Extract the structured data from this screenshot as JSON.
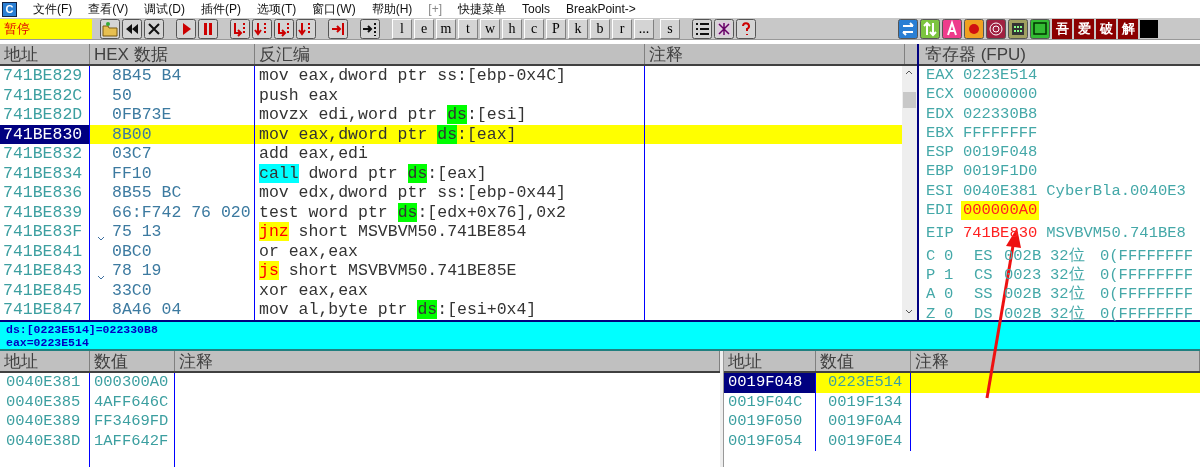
{
  "menu": {
    "logo_letter": "C",
    "items": [
      "文件(F)",
      "查看(V)",
      "调试(D)",
      "插件(P)",
      "选项(T)",
      "窗口(W)",
      "帮助(H)",
      "[+]",
      "快捷菜单",
      "Tools",
      "BreakPoint->"
    ]
  },
  "toolbar": {
    "status": "暂停",
    "letter_buttons": [
      "l",
      "e",
      "m",
      "t",
      "w",
      "h",
      "c",
      "P",
      "k",
      "b",
      "r",
      "...",
      "s"
    ],
    "crack_buttons": [
      "吾",
      "爱",
      "破",
      "解"
    ]
  },
  "disassembly": {
    "columns": [
      "地址",
      "HEX 数据",
      "反汇编",
      "注释"
    ],
    "rows": [
      {
        "address": "741BE829",
        "hex": "8B45 B4",
        "jump": false,
        "selected": false,
        "parts": [
          {
            "text": "mov eax,dword ptr ss:[ebp-0x4C]",
            "kind": "text"
          }
        ]
      },
      {
        "address": "741BE82C",
        "hex": "50",
        "jump": false,
        "selected": false,
        "parts": [
          {
            "text": "push eax",
            "kind": "text"
          }
        ]
      },
      {
        "address": "741BE82D",
        "hex": "0FB73E",
        "jump": false,
        "selected": false,
        "parts": [
          {
            "text": "movzx edi,word ptr ",
            "kind": "text"
          },
          {
            "text": "ds",
            "kind": "segment"
          },
          {
            "text": ":[esi]",
            "kind": "text"
          }
        ]
      },
      {
        "address": "741BE830",
        "hex": "8B00",
        "jump": false,
        "selected": true,
        "parts": [
          {
            "text": "mov eax,dword ptr ",
            "kind": "text"
          },
          {
            "text": "ds",
            "kind": "segment"
          },
          {
            "text": ":[eax]",
            "kind": "text"
          }
        ]
      },
      {
        "address": "741BE832",
        "hex": "03C7",
        "jump": false,
        "selected": false,
        "parts": [
          {
            "text": "add eax,edi",
            "kind": "text"
          }
        ]
      },
      {
        "address": "741BE834",
        "hex": "FF10",
        "jump": false,
        "selected": false,
        "parts": [
          {
            "text": "call",
            "kind": "call"
          },
          {
            "text": " dword ptr ",
            "kind": "text"
          },
          {
            "text": "ds",
            "kind": "segment"
          },
          {
            "text": ":[eax]",
            "kind": "text"
          }
        ]
      },
      {
        "address": "741BE836",
        "hex": "8B55 BC",
        "jump": false,
        "selected": false,
        "parts": [
          {
            "text": "mov edx,dword ptr ss:[ebp-0x44]",
            "kind": "text"
          }
        ]
      },
      {
        "address": "741BE839",
        "hex": "66:F742 76 020",
        "jump": false,
        "selected": false,
        "parts": [
          {
            "text": "test word ptr ",
            "kind": "text"
          },
          {
            "text": "ds",
            "kind": "segment"
          },
          {
            "text": ":[edx+0x76],0x2",
            "kind": "text"
          }
        ]
      },
      {
        "address": "741BE83F",
        "hex": "75 13",
        "jump": true,
        "selected": false,
        "parts": [
          {
            "text": "jnz",
            "kind": "jump"
          },
          {
            "text": " short MSVBVM50.741BE854",
            "kind": "text"
          }
        ]
      },
      {
        "address": "741BE841",
        "hex": "0BC0",
        "jump": false,
        "selected": false,
        "parts": [
          {
            "text": "or eax,eax",
            "kind": "text"
          }
        ]
      },
      {
        "address": "741BE843",
        "hex": "78 19",
        "jump": true,
        "selected": false,
        "parts": [
          {
            "text": "js",
            "kind": "jump"
          },
          {
            "text": " short MSVBVM50.741BE85E",
            "kind": "text"
          }
        ]
      },
      {
        "address": "741BE845",
        "hex": "33C0",
        "jump": false,
        "selected": false,
        "parts": [
          {
            "text": "xor eax,eax",
            "kind": "text"
          }
        ]
      },
      {
        "address": "741BE847",
        "hex": "8A46 04",
        "jump": false,
        "selected": false,
        "parts": [
          {
            "text": "mov al,byte ptr ",
            "kind": "text"
          },
          {
            "text": "ds",
            "kind": "segment"
          },
          {
            "text": ":[esi+0x4]",
            "kind": "text"
          }
        ]
      }
    ]
  },
  "info": [
    "ds:[0223E514]=022330B8",
    "eax=0223E514"
  ],
  "registers": {
    "title": "寄存器 (FPU)",
    "general": [
      {
        "name": "EAX",
        "value": "0223E514",
        "changed": false,
        "highlighted": false
      },
      {
        "name": "ECX",
        "value": "00000000",
        "changed": false,
        "highlighted": false
      },
      {
        "name": "EDX",
        "value": "022330B8",
        "changed": false,
        "highlighted": false
      },
      {
        "name": "EBX",
        "value": "FFFFFFFF",
        "changed": false,
        "highlighted": false
      },
      {
        "name": "ESP",
        "value": "0019F048",
        "changed": false,
        "highlighted": false
      },
      {
        "name": "EBP",
        "value": "0019F1D0",
        "changed": false,
        "highlighted": false
      },
      {
        "name": "ESI",
        "value": "0040E381",
        "note": "CyberBla.0040E3",
        "changed": false,
        "highlighted": false
      },
      {
        "name": "EDI",
        "value": "000000A0",
        "changed": true,
        "highlighted": true
      }
    ],
    "eip": {
      "name": "EIP",
      "value": "741BE830",
      "note": "MSVBVM50.741BE8",
      "changed": true,
      "highlighted": false
    },
    "flags": [
      {
        "flag": "C",
        "value": "0",
        "segment": "ES",
        "selector": "002B",
        "bits": "32位",
        "base": "0(FFFFFFFF"
      },
      {
        "flag": "P",
        "value": "1",
        "segment": "CS",
        "selector": "0023",
        "bits": "32位",
        "base": "0(FFFFFFFF"
      },
      {
        "flag": "A",
        "value": "0",
        "segment": "SS",
        "selector": "002B",
        "bits": "32位",
        "base": "0(FFFFFFFF"
      },
      {
        "flag": "Z",
        "value": "0",
        "segment": "DS",
        "selector": "002B",
        "bits": "32位",
        "base": "0(FFFFFFFF"
      }
    ]
  },
  "dump": {
    "columns": [
      "地址",
      "数值",
      "注释"
    ],
    "rows": [
      {
        "address": "0040E381",
        "value": "000300A0"
      },
      {
        "address": "0040E385",
        "value": "4AFF646C"
      },
      {
        "address": "0040E389",
        "value": "FF3469FD"
      },
      {
        "address": "0040E38D",
        "value": "1AFF642F"
      }
    ]
  },
  "stack": {
    "columns": [
      "地址",
      "数值",
      "注释"
    ],
    "rows": [
      {
        "address": "0019F048",
        "value": "0223E514",
        "selected": true
      },
      {
        "address": "0019F04C",
        "value": "0019F134",
        "selected": false
      },
      {
        "address": "0019F050",
        "value": "0019F0A4",
        "selected": false
      },
      {
        "address": "0019F054",
        "value": "0019F0E4",
        "selected": false
      }
    ]
  }
}
